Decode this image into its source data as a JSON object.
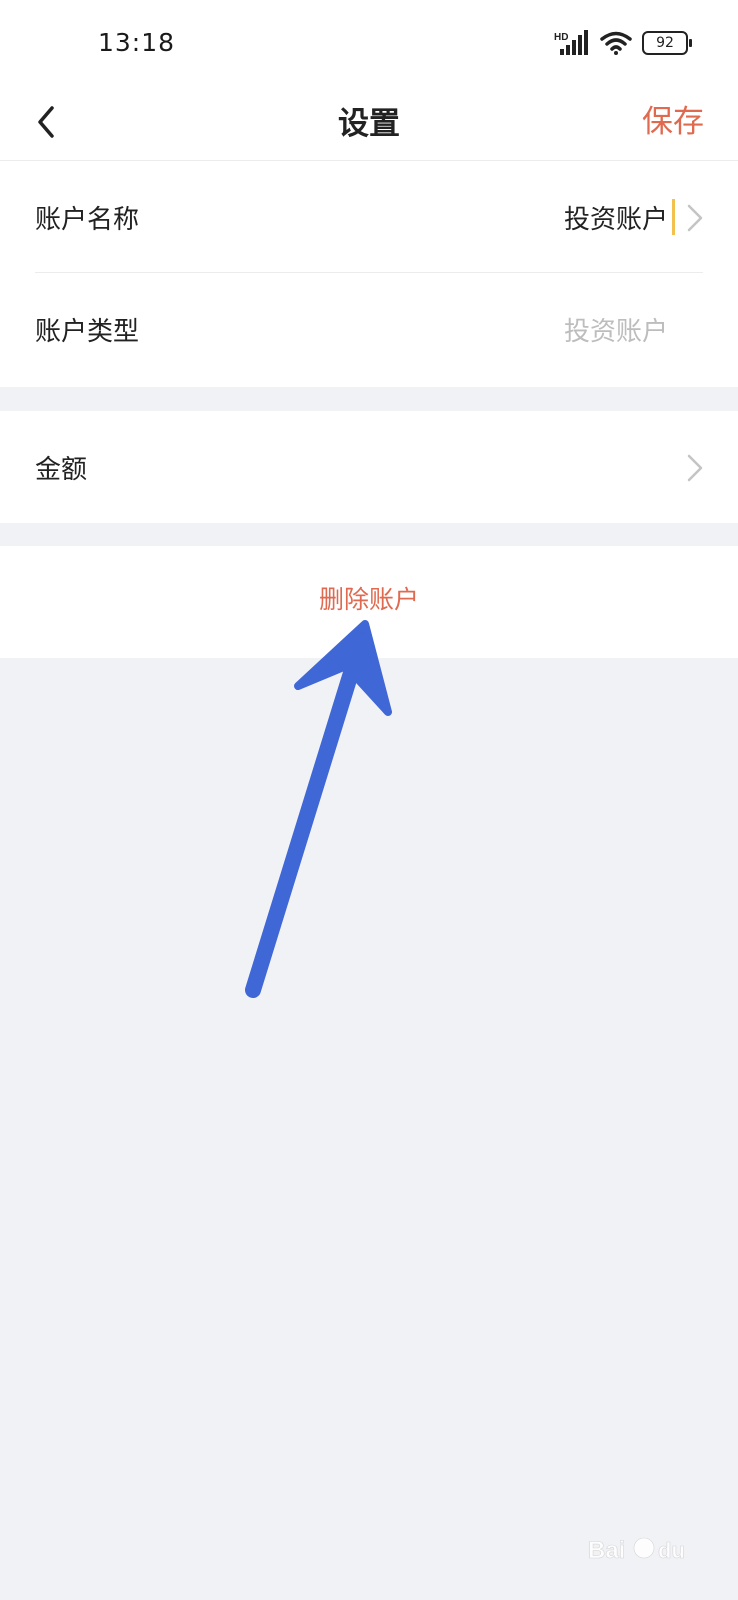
{
  "status_bar": {
    "time": "13:18",
    "network": "HD",
    "battery": "92"
  },
  "nav": {
    "title": "设置",
    "save_label": "保存"
  },
  "account_section": {
    "rows": [
      {
        "label": "账户名称",
        "value": "投资账户"
      },
      {
        "label": "账户类型",
        "value": "投资账户"
      }
    ]
  },
  "amount_section": {
    "label": "金额"
  },
  "delete_section": {
    "label": "删除账户"
  },
  "colors": {
    "accent": "#e06a50",
    "arrow": "#3f67d6",
    "background": "#f1f2f6",
    "cursor": "#f2c14e"
  },
  "icons": [
    "back-icon",
    "chevron-right-icon",
    "signal-icon",
    "wifi-icon",
    "battery-icon"
  ]
}
